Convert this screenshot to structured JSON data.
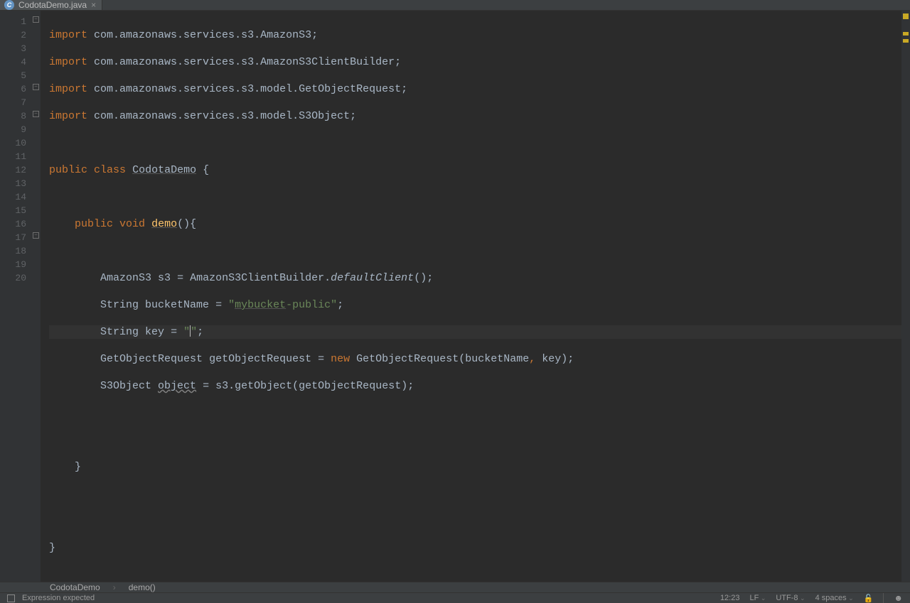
{
  "tab": {
    "filename": "CodotaDemo.java"
  },
  "line_numbers": [
    "1",
    "2",
    "3",
    "4",
    "5",
    "6",
    "7",
    "8",
    "9",
    "10",
    "11",
    "12",
    "13",
    "14",
    "15",
    "16",
    "17",
    "18",
    "19",
    "20"
  ],
  "code": {
    "import_kw": "import",
    "imports": [
      "com.amazonaws.services.s3.AmazonS3",
      "com.amazonaws.services.s3.AmazonS3ClientBuilder",
      "com.amazonaws.services.s3.model.GetObjectRequest",
      "com.amazonaws.services.s3.model.S3Object"
    ],
    "public_kw": "public",
    "class_kw": "class",
    "class_name": "CodotaDemo",
    "void_kw": "void",
    "method_name": "demo",
    "l10_type1": "AmazonS3",
    "l10_var": "s3",
    "l10_rhs_class": "AmazonS3ClientBuilder",
    "l10_rhs_method": "defaultClient",
    "l11_type": "String",
    "l11_var": "bucketName",
    "l11_str_a": "mybucket",
    "l11_str_b": "-public",
    "l12_type": "String",
    "l12_var": "key",
    "l12_str": "",
    "l13_type": "GetObjectRequest",
    "l13_var": "getObjectRequest",
    "new_kw": "new",
    "l13_ctor": "GetObjectRequest",
    "l13_arg1": "bucketName",
    "l13_arg2": "key",
    "l14_type": "S3Object",
    "l14_var": "object",
    "l14_obj": "s3",
    "l14_method": "getObject",
    "l14_arg": "getObjectRequest"
  },
  "breadcrumb": {
    "class": "CodotaDemo",
    "method": "demo()"
  },
  "status": {
    "message": "Expression expected",
    "position": "12:23",
    "line_sep": "LF",
    "encoding": "UTF-8",
    "indent": "4 spaces"
  }
}
